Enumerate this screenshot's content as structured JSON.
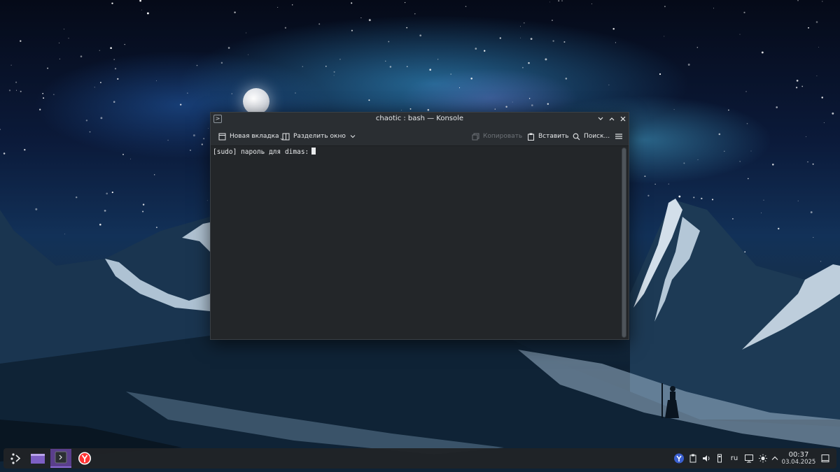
{
  "window": {
    "title": "chaotic : bash — Konsole",
    "app_icon": "terminal-icon"
  },
  "toolbar": {
    "new_tab_label": "Новая вкладка",
    "split_view_label": "Разделить окно",
    "copy_label": "Копировать",
    "paste_label": "Вставить",
    "find_label": "Поиск...",
    "menu_icon": "hamburger-menu-icon"
  },
  "terminal": {
    "prompt": "[sudo] пароль для dimas:"
  },
  "taskbar": {
    "launcher_icon": "plasma-launcher-icon",
    "apps": [
      {
        "name": "file-manager",
        "icon": "folder-icon"
      },
      {
        "name": "konsole",
        "icon": "terminal-icon",
        "active": true
      },
      {
        "name": "yandex-browser",
        "icon": "yandex-browser-icon"
      }
    ],
    "tray": {
      "keyboard_layout": "ru"
    },
    "clock": {
      "time": "00:37",
      "date": "03.04.2025"
    }
  },
  "colors": {
    "window_bg": "#232629",
    "titlebar_bg": "#2a2e32",
    "accent_active_task": "#5a3f8c",
    "taskbar_bg": "#202327"
  }
}
